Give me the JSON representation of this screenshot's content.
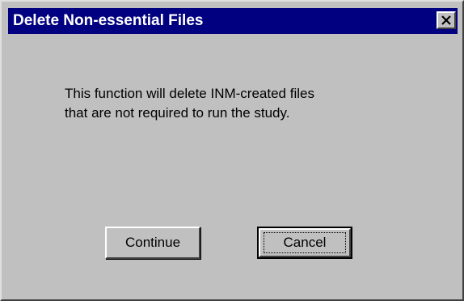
{
  "dialog": {
    "title": "Delete Non-essential Files",
    "close_icon": "close-icon"
  },
  "message": {
    "lines": [
      "This function will delete INM-created files",
      "that are not required to run the study."
    ]
  },
  "buttons": {
    "continue_label": "Continue",
    "cancel_label": "Cancel"
  },
  "colors": {
    "titlebar": "#000080",
    "window_face": "#c0c0c0",
    "title_text": "#ffffff"
  }
}
